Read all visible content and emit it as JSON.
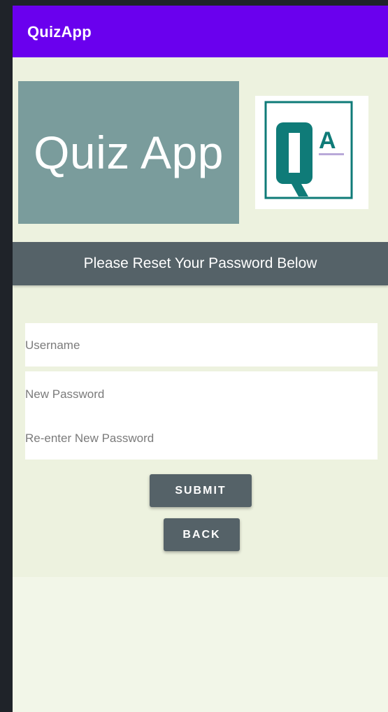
{
  "app": {
    "title": "QuizApp"
  },
  "banner": {
    "text": "Quiz App"
  },
  "logo": {
    "icon": "qa-logo-icon",
    "letters": "QA",
    "colors": {
      "primary": "#0f7b78",
      "underline": "#b9a9d9"
    }
  },
  "section": {
    "heading": "Please Reset Your Password Below"
  },
  "form": {
    "username_placeholder": "Username",
    "new_password_placeholder": "New Password",
    "reenter_password_placeholder": "Re-enter New Password",
    "submit_label": "SUBMIT",
    "back_label": "BACK"
  },
  "colors": {
    "appbar": "#6a00ee",
    "content_background": "#edf2df",
    "banner_background": "#7a9c9c",
    "section_background": "#556268",
    "button_background": "#556268"
  }
}
